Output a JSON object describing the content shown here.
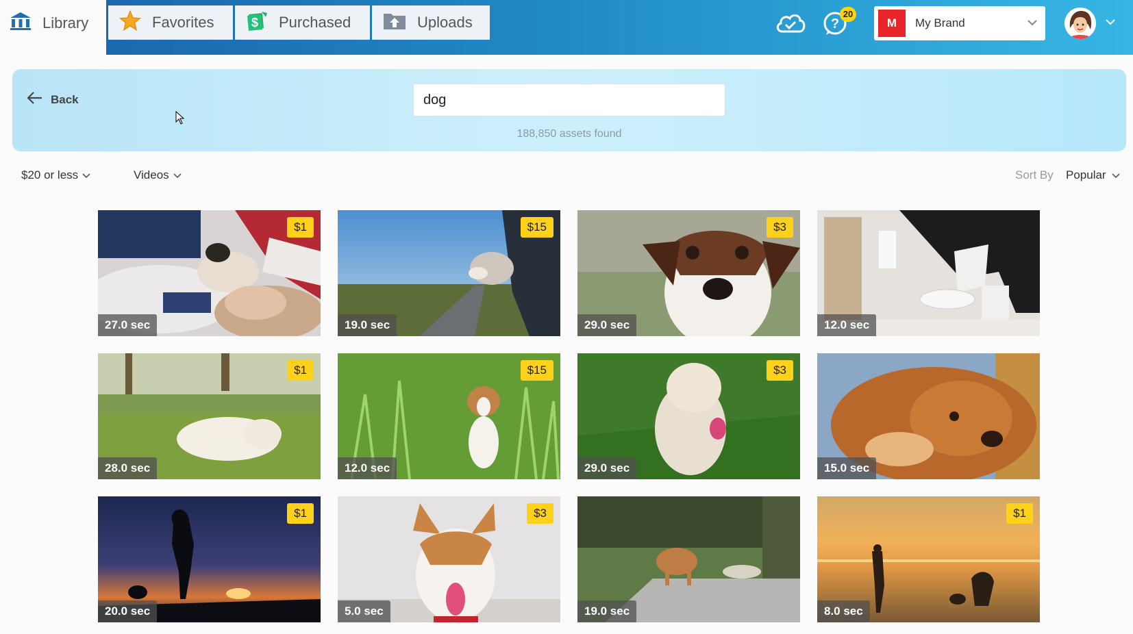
{
  "nav": {
    "tabs": [
      {
        "label": "Library",
        "icon": "library-icon",
        "active": true
      },
      {
        "label": "Favorites",
        "icon": "star-icon"
      },
      {
        "label": "Purchased",
        "icon": "money-icon"
      },
      {
        "label": "Uploads",
        "icon": "upload-folder-icon"
      }
    ],
    "help_badge": "20",
    "brand": {
      "logo_letter": "M",
      "name": "My Brand"
    }
  },
  "search": {
    "back_label": "Back",
    "query": "dog",
    "results_count": "188,850 assets found"
  },
  "filters": {
    "price": "$20 or less",
    "type": "Videos",
    "sort_label": "Sort By",
    "sort_value": "Popular"
  },
  "results": [
    {
      "price": "$1",
      "duration": "27.0 sec",
      "scene": "puppy-on-bed"
    },
    {
      "price": "$15",
      "duration": "19.0 sec",
      "scene": "dog-car-window"
    },
    {
      "price": "$3",
      "duration": "29.0 sec",
      "scene": "jack-russell-face"
    },
    {
      "price": "",
      "duration": "12.0 sec",
      "scene": "border-collie-bowl"
    },
    {
      "price": "$1",
      "duration": "28.0 sec",
      "scene": "golden-puppy-grass"
    },
    {
      "price": "$15",
      "duration": "12.0 sec",
      "scene": "terrier-tall-grass"
    },
    {
      "price": "$3",
      "duration": "29.0 sec",
      "scene": "poodle-on-lawn"
    },
    {
      "price": "",
      "duration": "15.0 sec",
      "scene": "brown-dog-lying"
    },
    {
      "price": "$1",
      "duration": "20.0 sec",
      "scene": "silhouette-sunset"
    },
    {
      "price": "$3",
      "duration": "5.0 sec",
      "scene": "corgi-mix-tongue"
    },
    {
      "price": "",
      "duration": "19.0 sec",
      "scene": "dog-backyard"
    },
    {
      "price": "$1",
      "duration": "8.0 sec",
      "scene": "beach-sunset-dogs"
    }
  ]
}
